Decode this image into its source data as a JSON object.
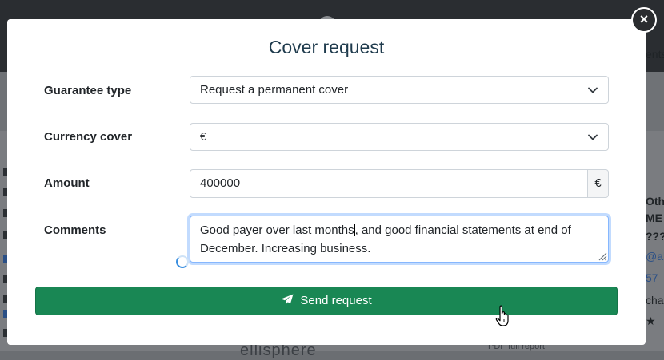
{
  "modal": {
    "title": "Cover request",
    "close_symbol": "×",
    "fields": {
      "guarantee_type": {
        "label": "Guarantee type",
        "value": "Request a permanent cover"
      },
      "currency_cover": {
        "label": "Currency cover",
        "value": "€"
      },
      "amount": {
        "label": "Amount",
        "value": "400000",
        "addon": "€"
      },
      "comments": {
        "label": "Comments",
        "value_before_caret": "Good payer over last months",
        "value_after_caret": ", and good financial statements at end of December. Increasing business."
      }
    },
    "send_button": {
      "label": "Send request",
      "icon": "paper-plane-icon"
    }
  },
  "background": {
    "right_column_text": [
      "ents",
      "Oth",
      "ME",
      "???",
      "@als",
      "57",
      "cha",
      "★"
    ],
    "bottom_text": "ellisphere",
    "bottom_right_text": "PDF full report"
  },
  "colors": {
    "primary_green": "#198754",
    "title_color": "#1f3b4d",
    "focus_border": "#86b7fe"
  }
}
